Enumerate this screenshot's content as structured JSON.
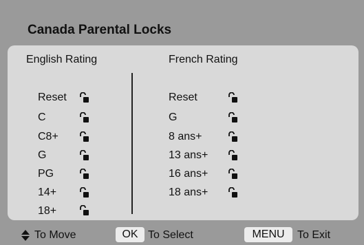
{
  "title": "Canada Parental Locks",
  "english": {
    "header": "English Rating",
    "items": [
      "Reset",
      "C",
      "C8+",
      "G",
      "PG",
      "14+",
      "18+"
    ]
  },
  "french": {
    "header": "French Rating",
    "items": [
      "Reset",
      "G",
      "8 ans+",
      "13 ans+",
      "16 ans+",
      "18 ans+"
    ]
  },
  "footer": {
    "move_label": "To Move",
    "ok_key": "OK",
    "select_label": "To Select",
    "menu_key": "MENU",
    "exit_label": "To Exit"
  },
  "icons": {
    "lock": "unlocked-padlock-icon",
    "move": "up-down-arrows-icon"
  },
  "colors": {
    "frame": "#9a9a9a",
    "panel": "#d9d9d9",
    "text": "#111111"
  }
}
